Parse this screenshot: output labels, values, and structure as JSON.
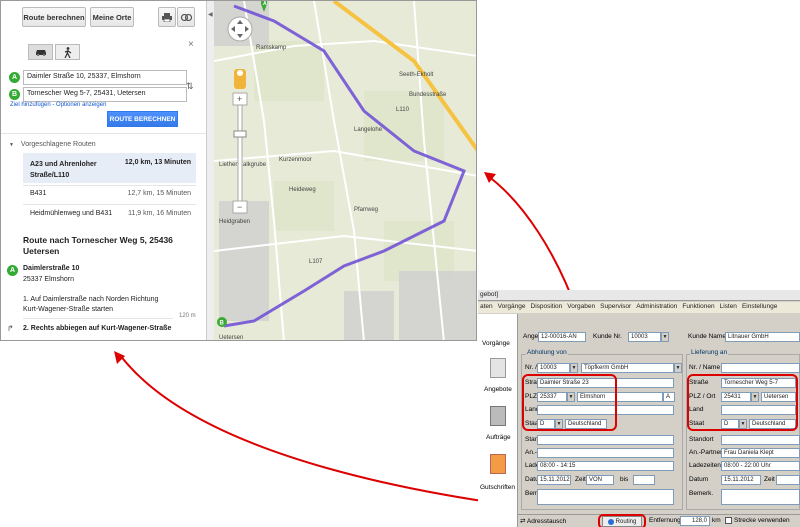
{
  "maps": {
    "toolbar": {
      "route_button": "Route berechnen",
      "my_places_button": "Meine Orte",
      "print_icon": "print-icon",
      "link_icon": "link-icon"
    },
    "close": "×",
    "modes": [
      "car-icon",
      "walk-icon"
    ],
    "waypoints": [
      {
        "marker": "A",
        "value": "Daimler Straße 10, 25337, Elmshorn"
      },
      {
        "marker": "B",
        "value": "Tornescher Weg 5-7, 25431, Uetersen"
      }
    ],
    "swap_icon": "⇅",
    "add_link": "Ziel hinzufügen",
    "options_link": "Optionen anzeigen",
    "calc_button": "ROUTE BERECHNEN",
    "suggested_title": "Vorgeschlagene Routen",
    "routes": [
      {
        "name": "A23 und Ahrenloher Straße/L110",
        "detail": "12,0 km, 13 Minuten"
      },
      {
        "name": "B431",
        "detail": "12,7 km, 15 Minuten"
      },
      {
        "name": "Heidmühlenweg und B431",
        "detail": "11,9 km, 16 Minuten"
      }
    ],
    "route_heading": "Route nach Tornescher Weg 5, 25436 Uetersen",
    "start_name": "Daimlerstraße 10",
    "start_city": "25337 Elmshorn",
    "steps": [
      {
        "num": "1.",
        "text": "Auf Daimlerstraße nach Norden Richtung Kurt-Wagener-Straße starten",
        "dist": "120 m"
      },
      {
        "num": "2.",
        "text": "Rechts abbiegen auf Kurt-Wagener-Straße"
      }
    ]
  },
  "map": {
    "labels": [
      "Ramskamp",
      "Seeth-Ekholt",
      "Heidgraben",
      "Uetersen",
      "Langelohe",
      "Kurzenmoor",
      "Heideweg",
      "L107",
      "L110",
      "Pfarrweg",
      "Liether Kalkgrube",
      "Bundesstraße"
    ],
    "colors": {
      "route": "#6b4ad6",
      "highway": "#f5c242",
      "marker": "#3aaa35"
    }
  },
  "app": {
    "title": "gebot]",
    "menu": [
      "aten",
      "Vorgänge",
      "Disposition",
      "Vorgaben",
      "Supervisor",
      "Administration",
      "Funktionen",
      "Listen",
      "Einstellunge"
    ],
    "side": [
      "Vorgänge",
      "Angebote",
      "Aufträge",
      "Gutschriften"
    ],
    "offer_label": "Angebot Nr.",
    "offer_value": "12-00016-AN",
    "customer_label": "Kunde Nr.",
    "customer_value": "10003",
    "customer_name_label": "Kunde Name",
    "customer_name_value": "Litnauer GmbH",
    "pickup": {
      "title": "Abholung von",
      "nr_label": "Nr. / Name",
      "nr": "10003",
      "name": "Töpfkerm GmbH",
      "street_label": "Straße",
      "street": "Daimler Straße 23",
      "plz_label": "PLZ / Ort",
      "plz": "25337",
      "city": "Elmshorn",
      "country_label": "Land",
      "state_label": "Staat",
      "state": "D",
      "state_name": "Deutschland",
      "location_label": "Standort",
      "contact_label": "An.-Partner",
      "times_label": "Ladezeiten",
      "times": "08:00 - 14:15",
      "date_label": "Datum",
      "date": "15.11.2012",
      "time_label": "Zeit",
      "from": "VON",
      "until": "bis",
      "remark_label": "Bemerk."
    },
    "delivery": {
      "title": "Lieferung an",
      "nr_label": "Nr. / Name",
      "street_label": "Straße",
      "street": "Tornescher Weg 5-7",
      "plz_label": "PLZ / Ort",
      "plz": "25431",
      "city": "Uetersen",
      "country_label": "Land",
      "state_label": "Staat",
      "state": "D",
      "state_name": "Deutschland",
      "location_label": "Standort",
      "contact_label": "An.-Partner",
      "contact": "Frau Daniela Klept",
      "times_label": "Ladezeiten",
      "times": "08:00 - 22:00 Uhr",
      "date_label": "Datum",
      "date": "15.11.2012",
      "time_label": "Zeit",
      "remark_label": "Bemerk."
    },
    "bottom": {
      "address_swap": "Adresstausch",
      "routing": "Routing",
      "distance_label": "Entfernung",
      "distance": "128,0",
      "unit": "km",
      "use_route": "Strecke verwenden"
    }
  }
}
